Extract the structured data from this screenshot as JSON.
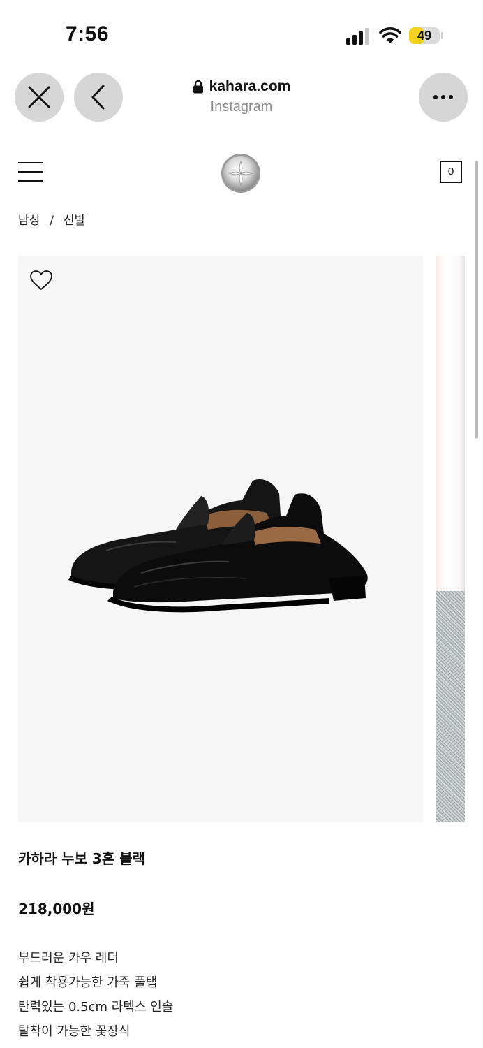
{
  "status_bar": {
    "time": "7:56",
    "battery_percent": "49",
    "battery_level": 0.49,
    "icons": [
      "cellular-signal-icon",
      "wifi-icon",
      "battery-icon"
    ]
  },
  "browser": {
    "domain": "kahara.com",
    "source": "Instagram",
    "icons": [
      "close-icon",
      "back-chevron-icon",
      "lock-icon",
      "more-icon"
    ]
  },
  "site_header": {
    "cart_count": "0",
    "icons": [
      "hamburger-menu-icon",
      "brand-logo",
      "cart-icon"
    ]
  },
  "breadcrumb": {
    "items": [
      "남성",
      "신발"
    ],
    "separator": "/"
  },
  "product": {
    "title": "카하라 누보 3혼 블랙",
    "price": "218,000원",
    "features": [
      "부드러운 카우 레더",
      "쉽게 착용가능한 가죽 풀탭",
      "탄력있는 0.5cm 라텍스 인솔",
      "탈착이 가능한 꽃장식"
    ]
  },
  "colors": {
    "battery_fill": "#f4d21f",
    "button_bg": "#d6d6d6",
    "image_bg": "#f6f6f6"
  }
}
